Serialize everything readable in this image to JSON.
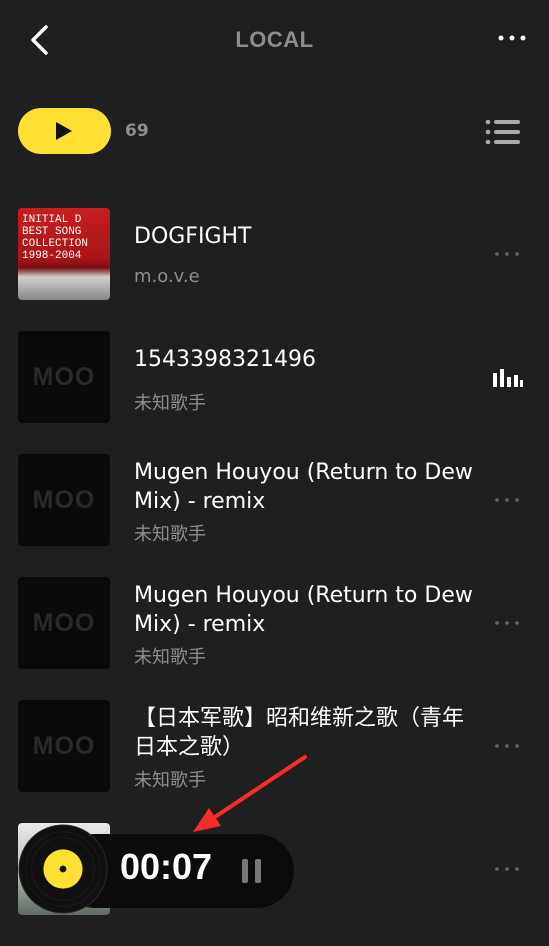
{
  "header": {
    "title": "LOCAL",
    "back_icon": "back-arrow-icon",
    "more_icon": "more-horizontal-icon"
  },
  "toolbar": {
    "play_icon": "play-icon",
    "count": "69",
    "list_icon": "list-menu-icon"
  },
  "accent_color": "#ffe033",
  "songs": [
    {
      "title": "DOGFIGHT",
      "artist": "m.o.v.e",
      "cover": "INITIAL D BEST SONG COLLECTION 1998-2004"
    },
    {
      "title": "1543398321496",
      "artist": "未知歌手",
      "cover": "MOO"
    },
    {
      "title": "Mugen Houyou (Return to Dew Mix) - remix",
      "artist": "未知歌手",
      "cover": "MOO"
    },
    {
      "title": "Mugen Houyou (Return to Dew Mix) - remix",
      "artist": "未知歌手",
      "cover": "MOO"
    },
    {
      "title": "【日本军歌】昭和维新之歌（青年日本之歌）",
      "artist": "未知歌手",
      "cover": "MOO"
    }
  ],
  "player": {
    "time": "00:07",
    "pause_icon": "pause-icon",
    "disc_icon": "vinyl-disc-icon"
  }
}
